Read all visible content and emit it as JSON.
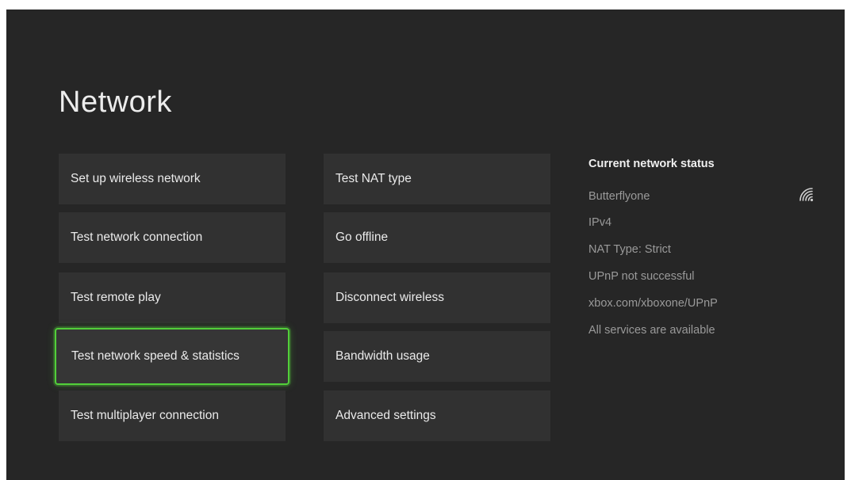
{
  "page": {
    "title": "Network"
  },
  "menu": {
    "left_column": [
      {
        "label": "Set up wireless network"
      },
      {
        "label": "Test network connection"
      },
      {
        "label": "Test remote play"
      },
      {
        "label": "Test network speed & statistics",
        "focused": true
      },
      {
        "label": "Test multiplayer connection"
      }
    ],
    "right_column": [
      {
        "label": "Test NAT type"
      },
      {
        "label": "Go offline"
      },
      {
        "label": "Disconnect wireless"
      },
      {
        "label": "Bandwidth usage"
      },
      {
        "label": "Advanced settings"
      }
    ]
  },
  "status": {
    "title": "Current network status",
    "network_name": "Butterflyone",
    "network_icon": "wifi-signal-icon",
    "lines": [
      "IPv4",
      "NAT Type: Strict",
      "UPnP not successful",
      "xbox.com/xboxone/UPnP",
      "All services are available"
    ]
  },
  "colors": {
    "background": "#262626",
    "tile": "#313131",
    "focus_accent": "#52d03a",
    "secondary_text": "#9a9a9a"
  }
}
